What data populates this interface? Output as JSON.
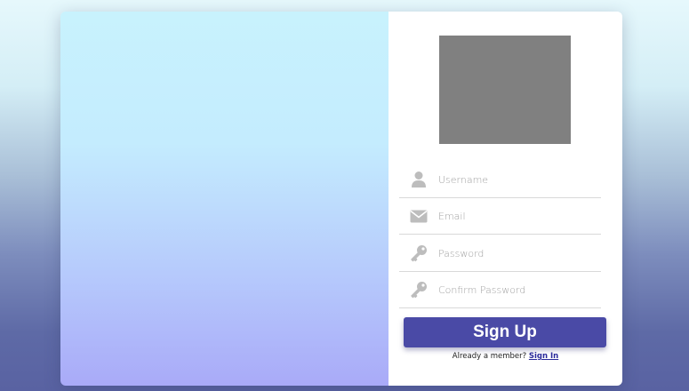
{
  "form": {
    "username_placeholder": "Username",
    "email_placeholder": "Email",
    "password_placeholder": "Password",
    "confirm_password_placeholder": "Confirm Password",
    "submit_label": "Sign Up",
    "member_prompt": "Already a member?",
    "signin_link": "Sign In"
  },
  "icons": {
    "username": "user-icon",
    "email": "envelope-icon",
    "password": "key-icon",
    "confirm_password": "key-icon"
  },
  "colors": {
    "primary_button": "#4a4aa6",
    "icon_gray": "#bdbdbd",
    "logo_placeholder": "#808080",
    "link": "#2a2a9a"
  }
}
